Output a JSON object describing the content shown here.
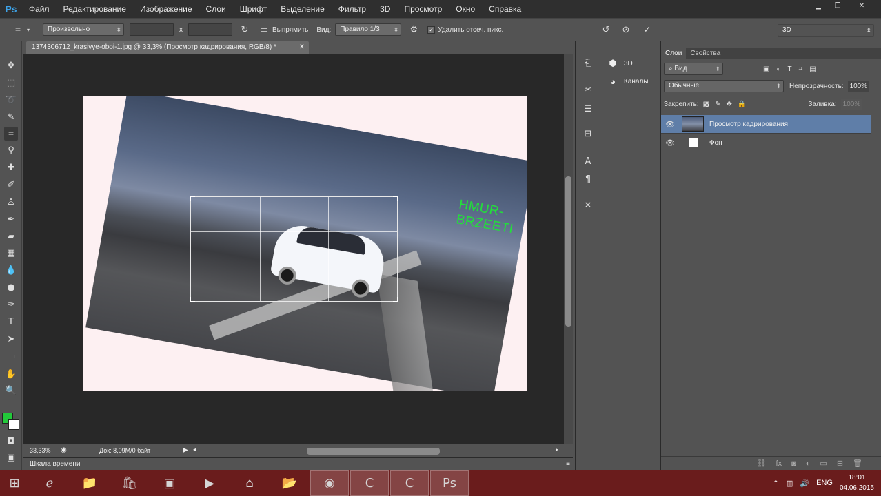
{
  "app": {
    "logo": "Ps",
    "menu": [
      "Файл",
      "Редактирование",
      "Изображение",
      "Слои",
      "Шрифт",
      "Выделение",
      "Фильтр",
      "3D",
      "Просмотр",
      "Окно",
      "Справка"
    ]
  },
  "options": {
    "ratio": "Произвольно",
    "x_sep": "x",
    "straighten": "Выпрямить",
    "view_label": "Вид:",
    "view_value": "Правило 1/3",
    "delete_cropped": "Удалить отсеч. пикс.",
    "workspace": "3D"
  },
  "document": {
    "tab_title": "1374306712_krasivye-oboi-1.jpg @ 33,3% (Просмотр кадрирования, RGB/8) *",
    "watermark": "HMUR-BRZEETI",
    "zoom": "33,33%",
    "doc_info": "Док: 8,09M/0 байт"
  },
  "timeline": {
    "label": "Шкала времени"
  },
  "side_panels": {
    "items": [
      {
        "icon": "cube-icon",
        "label": "3D"
      },
      {
        "icon": "channels-icon",
        "label": "Каналы"
      }
    ]
  },
  "layers_panel": {
    "tabs": [
      "Слои",
      "Свойства"
    ],
    "filter_label": "Вид",
    "blend_mode": "Обычные",
    "opacity_label": "Непрозрачность:",
    "opacity_value": "100%",
    "lock_label": "Закрепить:",
    "fill_label": "Заливка:",
    "fill_value": "100%",
    "layers": [
      {
        "name": "Просмотр кадрирования",
        "selected": true
      },
      {
        "name": "Фон",
        "selected": false
      }
    ]
  },
  "taskbar": {
    "lang": "ENG",
    "time": "18:01",
    "date": "04.06.2015"
  },
  "colors": {
    "accent_selected": "#5f7ea8",
    "foreground_swatch": "#22c93a",
    "watermark": "#22e03a",
    "taskbar": "#6a1c1c"
  }
}
